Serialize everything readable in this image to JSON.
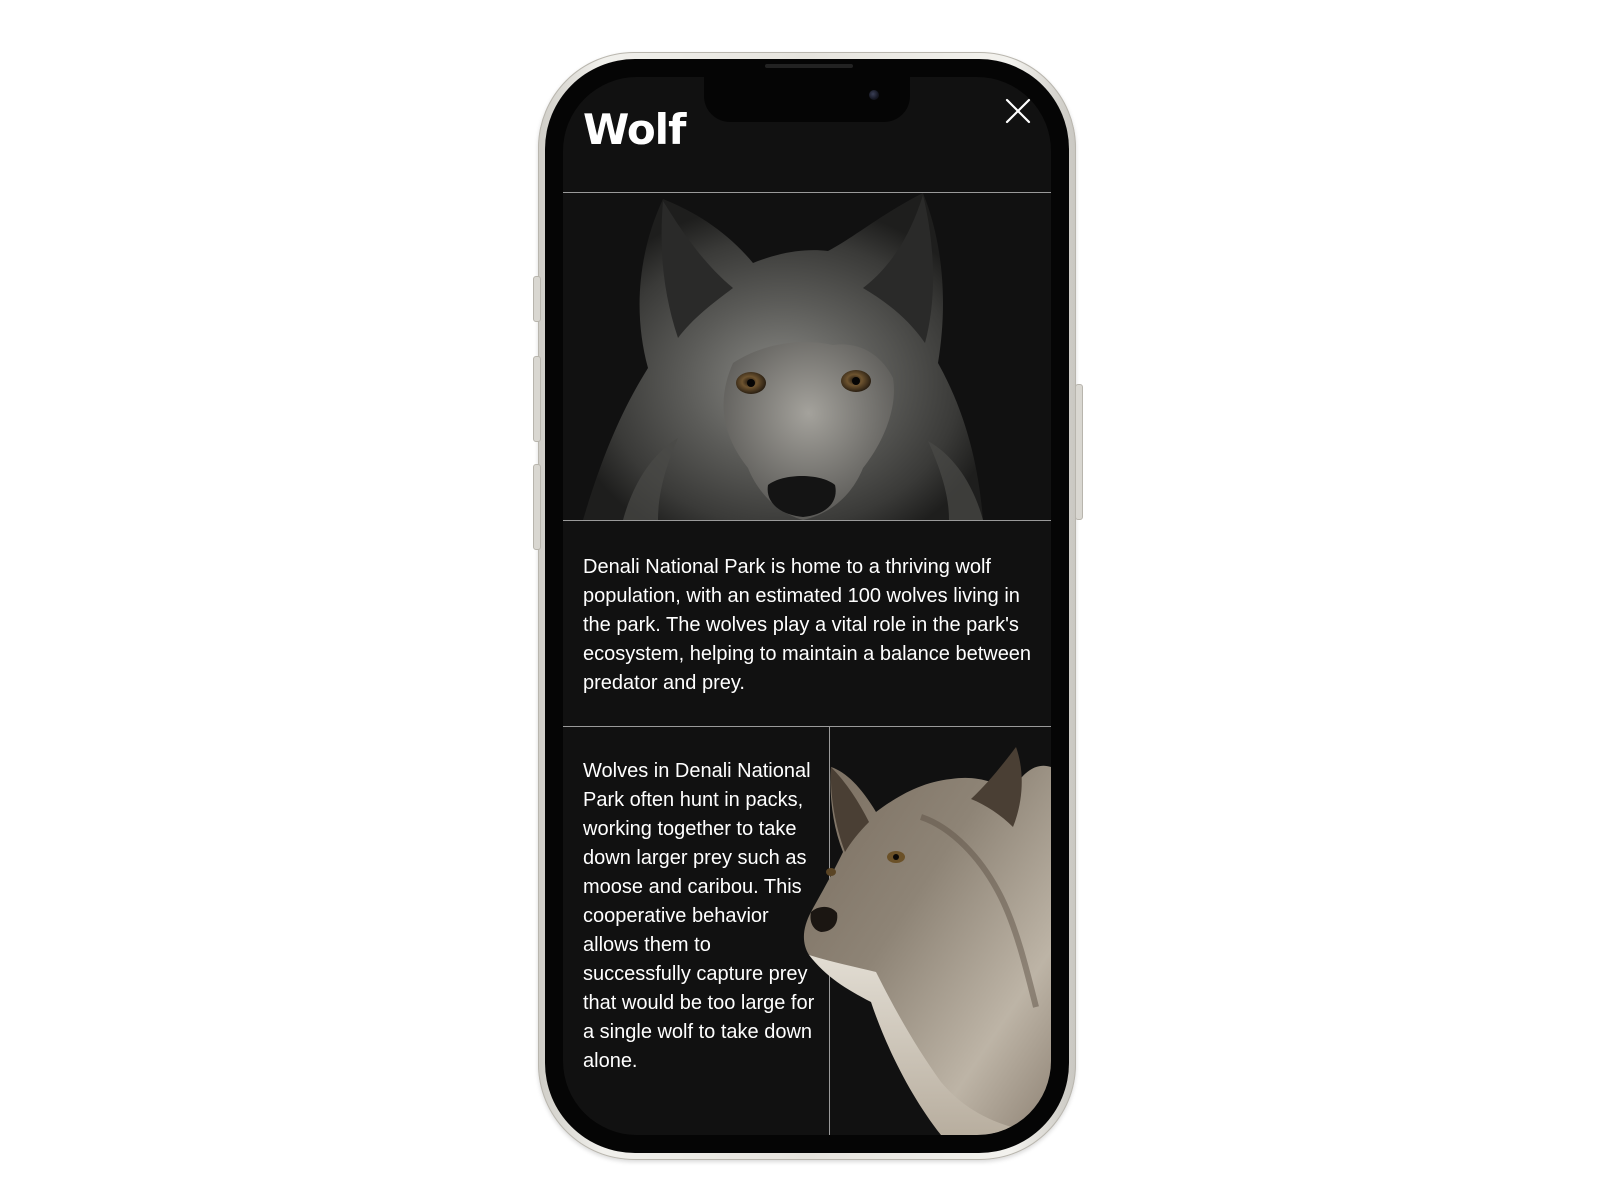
{
  "page": {
    "title": "Wolf"
  },
  "header": {
    "close_icon": "close-icon"
  },
  "images": {
    "hero": "wolf-face-photo",
    "side": "wolf-profile-photo"
  },
  "content": {
    "paragraph1": "Denali National Park is home to a thriving wolf population, with an estimated 100 wolves living in the park. The wolves play a vital role in the park's ecosystem, helping to maintain a balance between predator and prey.",
    "paragraph2": "Wolves in Denali National Park often hunt in packs, working together to take down larger prey such as moose and caribou. This cooperative behavior allows them to successfully capture prey that would be too large for a single wolf to take down alone."
  },
  "colors": {
    "screen_background": "#111111",
    "text": "#ffffff",
    "divider": "#9a9a9a",
    "frame": "#e6e4de"
  }
}
